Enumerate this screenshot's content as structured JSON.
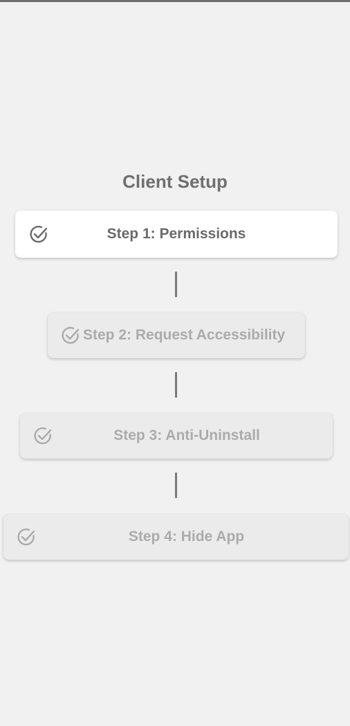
{
  "screen": {
    "title": "Client Setup"
  },
  "steps": [
    {
      "label": "Step 1: Permissions",
      "state": "active",
      "icon": "check-circle-icon"
    },
    {
      "label": "Step 2: Request Accessibility",
      "state": "inactive",
      "icon": "check-circle-icon"
    },
    {
      "label": "Step 3: Anti-Uninstall",
      "state": "inactive",
      "icon": "check-circle-icon"
    },
    {
      "label": "Step 4: Hide App",
      "state": "inactive",
      "icon": "check-circle-icon"
    }
  ],
  "colors": {
    "background": "#f1f1f1",
    "active_card": "#ffffff",
    "inactive_card": "#ebebeb",
    "active_text": "#6a6a6a",
    "inactive_text": "#ababab",
    "connector": "#7a7a7a"
  }
}
